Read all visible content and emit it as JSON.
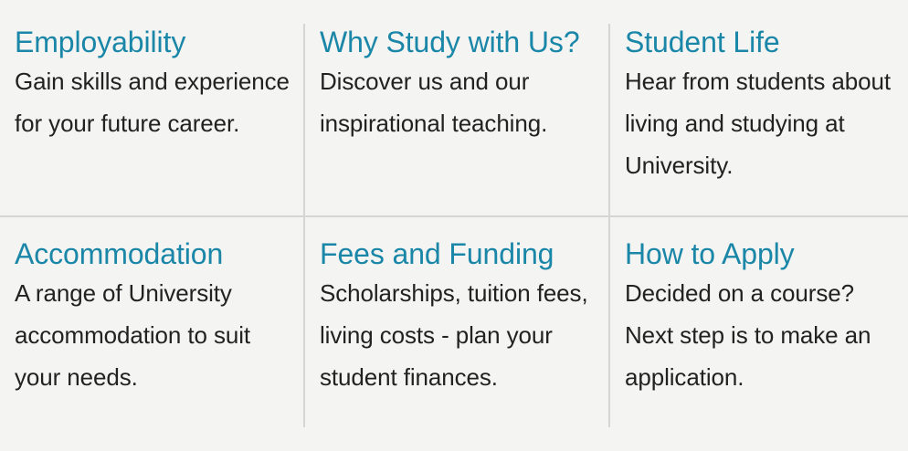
{
  "colors": {
    "background": "#f4f4f2",
    "link": "#1a86a8",
    "text": "#222222",
    "divider": "#d5d5d3"
  },
  "tiles": [
    {
      "title": "Employability",
      "description": "Gain skills and experience for your future career."
    },
    {
      "title": "Why Study with Us?",
      "description": "Discover us and our inspirational teaching."
    },
    {
      "title": "Student Life",
      "description": "Hear from students about living and studying at University."
    },
    {
      "title": "Accommodation",
      "description": "A range of University accommodation to suit your needs."
    },
    {
      "title": "Fees and Funding",
      "description": "Scholarships, tuition fees, living costs - plan your student finances."
    },
    {
      "title": "How to Apply",
      "description": "Decided on a course? Next step is to make an application."
    }
  ]
}
